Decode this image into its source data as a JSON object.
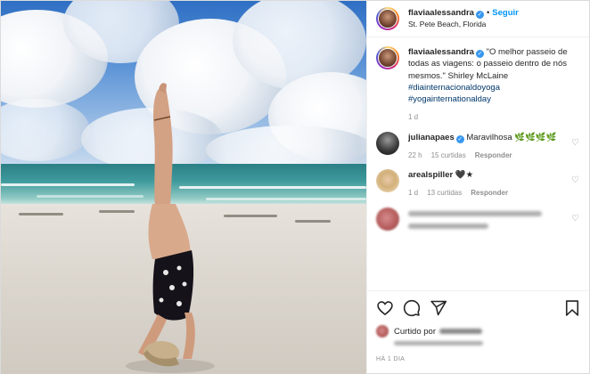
{
  "header": {
    "username": "flaviaalessandra",
    "follow_label": "Seguir",
    "location": "St. Pete Beach, Florida",
    "separator": "•"
  },
  "caption": {
    "username": "flaviaalessandra",
    "text": "\"O melhor passeio de todas as viagens: o passeio dentro de nós mesmos.\" Shirley McLaine",
    "hashtags": [
      "#diainternacionaldoyoga",
      "#yogainternationalday"
    ],
    "time": "1 d"
  },
  "comments": [
    {
      "username": "julianapaes",
      "text": "Maravilhosa 🌿🌿🌿🌿",
      "time": "22 h",
      "likes": "15 curtidas",
      "reply": "Responder"
    },
    {
      "username": "arealspiller",
      "text": "🖤★",
      "time": "1 d",
      "likes": "13 curtidas",
      "reply": "Responder"
    }
  ],
  "actions": {
    "icons": [
      "heart-outline-icon",
      "comment-icon",
      "share-icon",
      "bookmark-icon"
    ],
    "liked_by_prefix": "Curtido por",
    "timestamp": "HÁ 1 DIA"
  },
  "colors": {
    "link_blue": "#0095f6",
    "verified_blue": "#3897f0",
    "hashtag": "#00376b",
    "muted": "#8e8e8e"
  }
}
